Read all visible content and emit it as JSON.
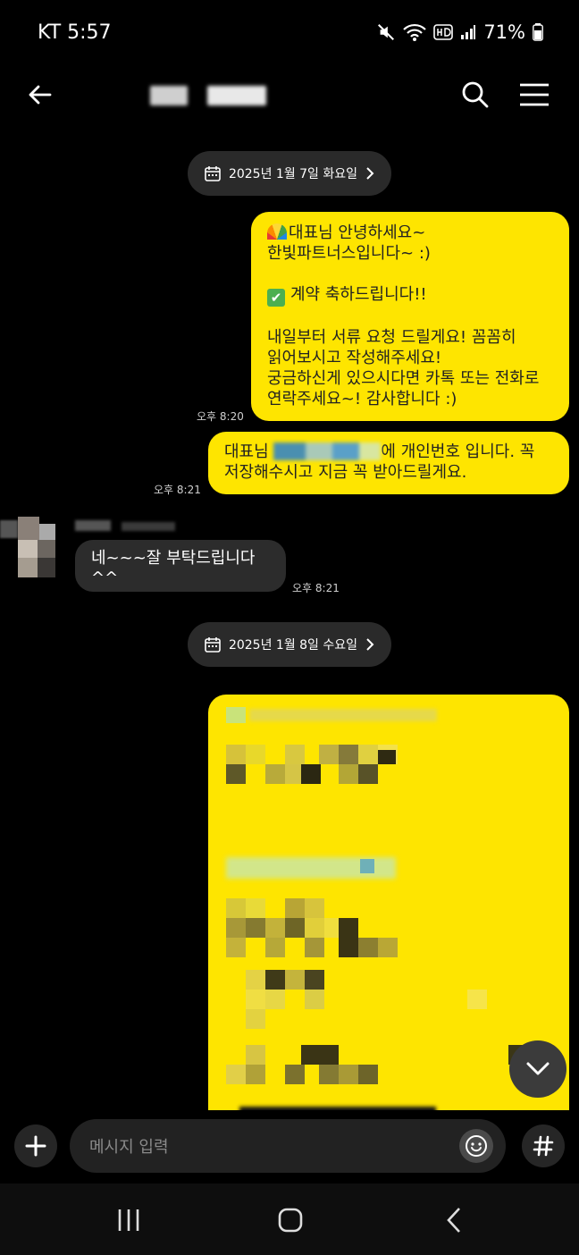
{
  "status_bar": {
    "carrier_time": "KT 5:57",
    "battery": "71%"
  },
  "header": {},
  "dates": {
    "first": "2025년 1월 7일 화요일",
    "second": "2025년 1월 8일 수요일"
  },
  "messages": {
    "m1": {
      "lines": [
        "대표님 안녕하세요~",
        "한빛파트너스입니다~ :)",
        "",
        "계약 축하드립니다!!",
        "",
        "내일부터 서류 요청 드릴게요! 꼼꼼히",
        "읽어보시고 작성해주세요!",
        "궁금하신게 있으시다면 카톡 또는 전화로",
        "연락주세요~! 감사합니다 :)"
      ],
      "time": "오후 8:20"
    },
    "m2": {
      "prefix": "대표님 ",
      "suffix": "에 개인번호 입니다. 꼭",
      "line2_a": "저장해수시고 ",
      "line2_b": "지금 꼭 받아드릴게요.",
      "time": "오후 8:21"
    },
    "m3": {
      "text": "네~~~잘 부탁드립니다^^",
      "time": "오후 8:21"
    }
  },
  "composer": {
    "placeholder": "메시지 입력"
  },
  "colors": {
    "bubble_out": "#fee500",
    "bubble_in": "#2c2c2c",
    "background": "#000000"
  }
}
